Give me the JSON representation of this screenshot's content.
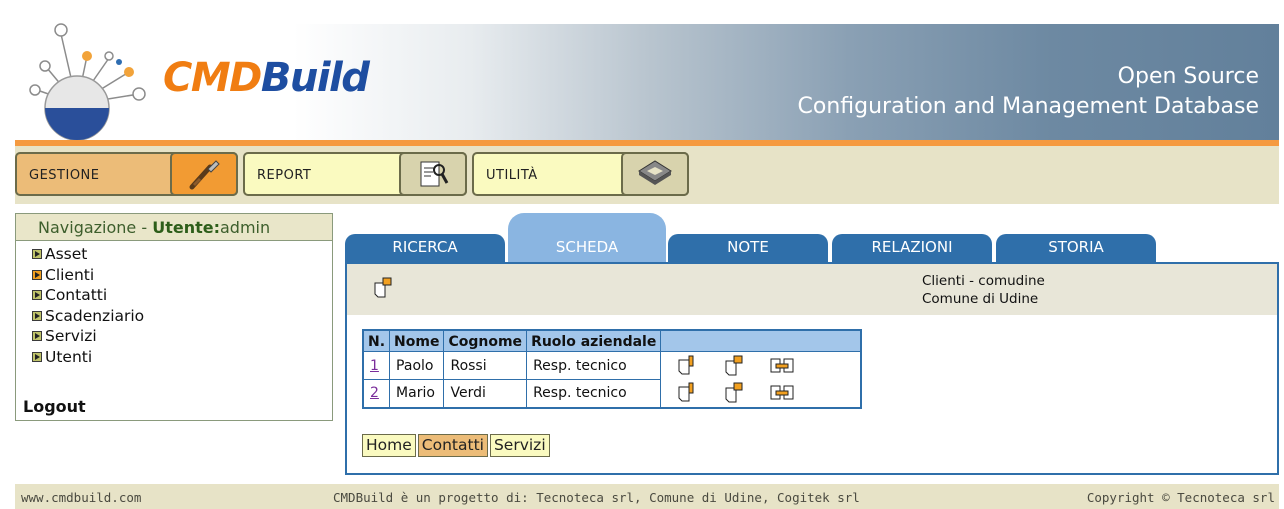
{
  "header": {
    "logo_part1": "CMD",
    "logo_part2": "Build",
    "tagline_line1": "Open Source",
    "tagline_line2": "Configuration and Management Database"
  },
  "menu": [
    {
      "label": "GESTIONE",
      "icon": "tools-icon",
      "active": true
    },
    {
      "label": "REPORT",
      "icon": "report-magnifier-icon",
      "active": false
    },
    {
      "label": "UTILITÀ",
      "icon": "utilities-icon",
      "active": false
    }
  ],
  "nav": {
    "title_prefix": "Navigazione - ",
    "user_label": "Utente:",
    "username": "admin",
    "items": [
      "Asset",
      "Clienti",
      "Contatti",
      "Scadenziario",
      "Servizi",
      "Utenti"
    ],
    "active_item": "Clienti",
    "logout": "Logout"
  },
  "tabs": [
    "RICERCA",
    "SCHEDA",
    "NOTE",
    "RELAZIONI",
    "STORIA"
  ],
  "active_tab": "SCHEDA",
  "record": {
    "line1": "Clienti - comudine",
    "line2": "Comune di Udine"
  },
  "table": {
    "headers": [
      "N.",
      "Nome",
      "Cognome",
      "Ruolo aziendale"
    ],
    "rows": [
      {
        "n": "1",
        "nome": "Paolo",
        "cognome": "Rossi",
        "ruolo": "Resp. tecnico"
      },
      {
        "n": "2",
        "nome": "Mario",
        "cognome": "Verdi",
        "ruolo": "Resp. tecnico"
      }
    ],
    "row_actions": [
      "edit-card-icon",
      "new-card-icon",
      "relations-icon"
    ]
  },
  "breadcrumb": [
    "Home",
    "Contatti",
    "Servizi"
  ],
  "breadcrumb_active": "Contatti",
  "footer": {
    "left": "www.cmdbuild.com",
    "middle": "CMDBuild è un progetto di: Tecnoteca srl, Comune di Udine, Cogitek srl",
    "right": "Copyright © Tecnoteca srl"
  },
  "colors": {
    "accent_orange": "#f59a40",
    "tab_blue": "#2f6faa",
    "active_tab": "#8ab5e1",
    "menu_bg": "#e7e3c7"
  }
}
